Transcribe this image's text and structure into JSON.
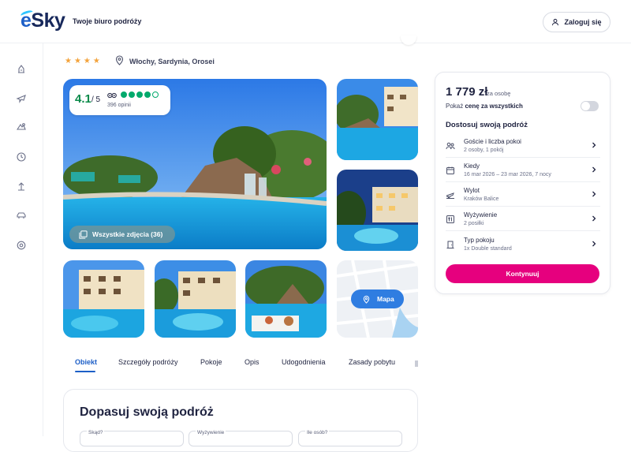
{
  "header": {
    "logo": "eSky",
    "tagline": "Twoje biuro podróży",
    "login_label": "Zaloguj się"
  },
  "sidebar": {
    "icons": [
      "hotel-icon",
      "flight-icon",
      "flight-hotel-icon",
      "last-minute-icon",
      "travel-icon",
      "car-icon",
      "settings-icon"
    ]
  },
  "hotel": {
    "stars": "★★★★",
    "location": "Włochy, Sardynia, Orosei",
    "rating": {
      "score": "4.1",
      "of": "/ 5",
      "count": "396 opinii",
      "dots_filled": 4,
      "dots_total": 5
    },
    "all_photos_label": "Wszystkie zdjęcia (36)",
    "map_label": "Mapa"
  },
  "tabs": [
    "Obiekt",
    "Szczegóły podróży",
    "Pokoje",
    "Opis",
    "Udogodnienia",
    "Zasady pobytu"
  ],
  "adjust": {
    "title": "Dopasuj swoją podróż",
    "fields": [
      "Skąd?",
      "Wyżywienie",
      "Ile osób?"
    ]
  },
  "booking": {
    "price": "1 779 zł",
    "price_suffix": "za osobę",
    "toggle_label_prefix": "Pokaż",
    "toggle_label_bold": "cenę za wszystkich",
    "section_title": "Dostosuj swoją podróż",
    "options": [
      {
        "icon": "guests-icon",
        "label": "Goście i liczba pokoi",
        "value": "2 osoby, 1 pokój"
      },
      {
        "icon": "calendar-icon",
        "label": "Kiedy",
        "value": "16 mar 2026 – 23 mar 2026, 7 nocy"
      },
      {
        "icon": "departure-icon",
        "label": "Wylot",
        "value": "Kraków Balice"
      },
      {
        "icon": "meal-icon",
        "label": "Wyżywienie",
        "value": "2 posiłki"
      },
      {
        "icon": "room-icon",
        "label": "Typ pokoju",
        "value": "1x Double standard"
      }
    ],
    "cta_label": "Kontynuuj"
  },
  "colors": {
    "brand": "#17285b",
    "accent": "#1d5fc7",
    "cta": "#e6007e",
    "rating_green": "#00aa6c"
  }
}
